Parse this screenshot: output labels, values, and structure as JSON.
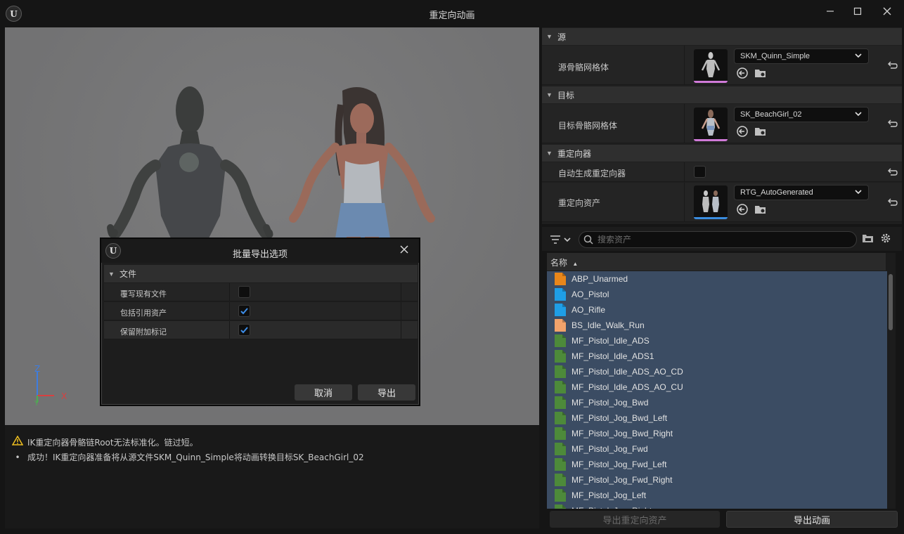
{
  "window": {
    "title": "重定向动画",
    "logo": "U"
  },
  "log": {
    "warning": "IK重定向器骨骼链Root无法标准化。链过短。",
    "success": "成功！IK重定向器准备将从源文件SKM_Quinn_Simple将动画转换目标SK_BeachGirl_02"
  },
  "axis": {
    "z": "Z",
    "x": "X",
    "y": "Y"
  },
  "details": {
    "source": {
      "header": "源",
      "label": "源骨骼网格体",
      "value": "SKM_Quinn_Simple",
      "accent": "#d07ad8"
    },
    "target": {
      "header": "目标",
      "label": "目标骨骼网格体",
      "value": "SK_BeachGirl_02",
      "accent": "#d07ad8"
    },
    "retargeter": {
      "header": "重定向器",
      "auto_label": "自动生成重定向器",
      "asset_label": "重定向资产",
      "value": "RTG_AutoGenerated",
      "accent": "#3a8de0"
    }
  },
  "browser": {
    "search_placeholder": "搜索资产",
    "column_name": "名称",
    "items": [
      {
        "name": "ABP_Unarmed",
        "color": "#e8861a"
      },
      {
        "name": "AO_Pistol",
        "color": "#1f9ee6"
      },
      {
        "name": "AO_Rifle",
        "color": "#1f9ee6"
      },
      {
        "name": "BS_Idle_Walk_Run",
        "color": "#f2a36b"
      },
      {
        "name": "MF_Pistol_Idle_ADS",
        "color": "#4d8a3a"
      },
      {
        "name": "MF_Pistol_Idle_ADS1",
        "color": "#4d8a3a"
      },
      {
        "name": "MF_Pistol_Idle_ADS_AO_CD",
        "color": "#4d8a3a"
      },
      {
        "name": "MF_Pistol_Idle_ADS_AO_CU",
        "color": "#4d8a3a"
      },
      {
        "name": "MF_Pistol_Jog_Bwd",
        "color": "#4d8a3a"
      },
      {
        "name": "MF_Pistol_Jog_Bwd_Left",
        "color": "#4d8a3a"
      },
      {
        "name": "MF_Pistol_Jog_Bwd_Right",
        "color": "#4d8a3a"
      },
      {
        "name": "MF_Pistol_Jog_Fwd",
        "color": "#4d8a3a"
      },
      {
        "name": "MF_Pistol_Jog_Fwd_Left",
        "color": "#4d8a3a"
      },
      {
        "name": "MF_Pistol_Jog_Fwd_Right",
        "color": "#4d8a3a"
      },
      {
        "name": "MF_Pistol_Jog_Left",
        "color": "#4d8a3a"
      },
      {
        "name": "MF_Pistol_Jog_Right",
        "color": "#4d8a3a"
      }
    ],
    "export_retarget_label": "导出重定向资产",
    "export_anim_label": "导出动画"
  },
  "dialog": {
    "title": "批量导出选项",
    "section": "文件",
    "rows": [
      {
        "label": "覆写现有文件",
        "checked": false
      },
      {
        "label": "包括引用资产",
        "checked": true
      },
      {
        "label": "保留附加标记",
        "checked": true
      }
    ],
    "cancel_label": "取消",
    "export_label": "导出"
  }
}
